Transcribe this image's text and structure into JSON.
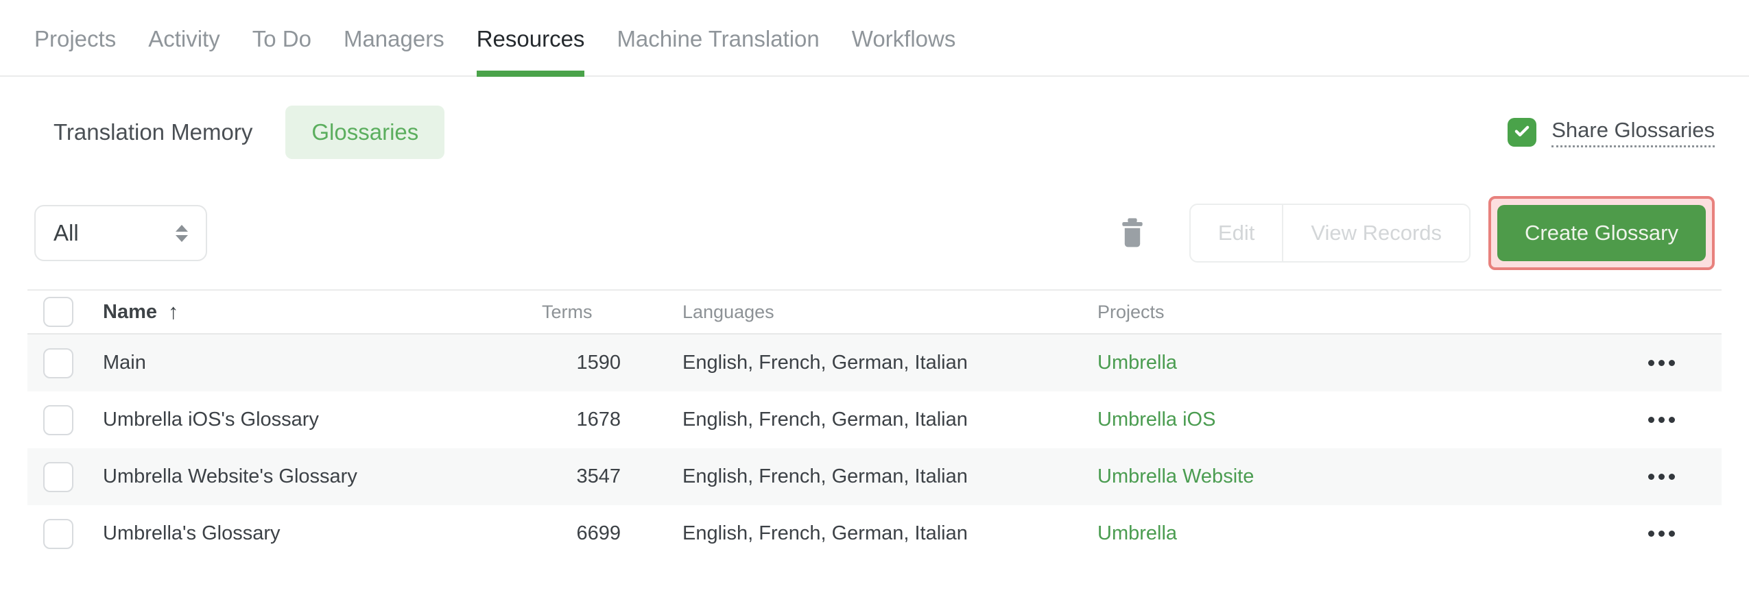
{
  "nav": {
    "tabs": [
      {
        "label": "Projects",
        "active": false
      },
      {
        "label": "Activity",
        "active": false
      },
      {
        "label": "To Do",
        "active": false
      },
      {
        "label": "Managers",
        "active": false
      },
      {
        "label": "Resources",
        "active": true
      },
      {
        "label": "Machine Translation",
        "active": false
      },
      {
        "label": "Workflows",
        "active": false
      }
    ]
  },
  "subtabs": {
    "items": [
      {
        "label": "Translation Memory",
        "active": false
      },
      {
        "label": "Glossaries",
        "active": true
      }
    ]
  },
  "share_glossaries": {
    "label": "Share Glossaries",
    "checked": true
  },
  "toolbar": {
    "filter": {
      "value": "All"
    },
    "edit_label": "Edit",
    "view_records_label": "View Records",
    "create_label": "Create Glossary"
  },
  "table": {
    "headers": {
      "name": "Name",
      "terms": "Terms",
      "languages": "Languages",
      "projects": "Projects"
    },
    "sort_indicator": "↑",
    "rows": [
      {
        "name": "Main",
        "terms": 1590,
        "languages": "English, French, German, Italian",
        "project": "Umbrella"
      },
      {
        "name": "Umbrella iOS's Glossary",
        "terms": 1678,
        "languages": "English, French, German, Italian",
        "project": "Umbrella iOS"
      },
      {
        "name": "Umbrella Website's Glossary",
        "terms": 3547,
        "languages": "English, French, German, Italian",
        "project": "Umbrella Website"
      },
      {
        "name": "Umbrella's Glossary",
        "terms": 6699,
        "languages": "English, French, German, Italian",
        "project": "Umbrella"
      }
    ]
  },
  "colors": {
    "accent_green": "#4aa34a",
    "pill_bg": "#e7f3e7",
    "pill_text": "#5bae5e",
    "link_green": "#4a9c50",
    "button_green": "#4e9b4a",
    "highlight_border": "#e8817d",
    "highlight_bg": "#fcdfdf",
    "row_stripe": "#f7f8f8"
  }
}
